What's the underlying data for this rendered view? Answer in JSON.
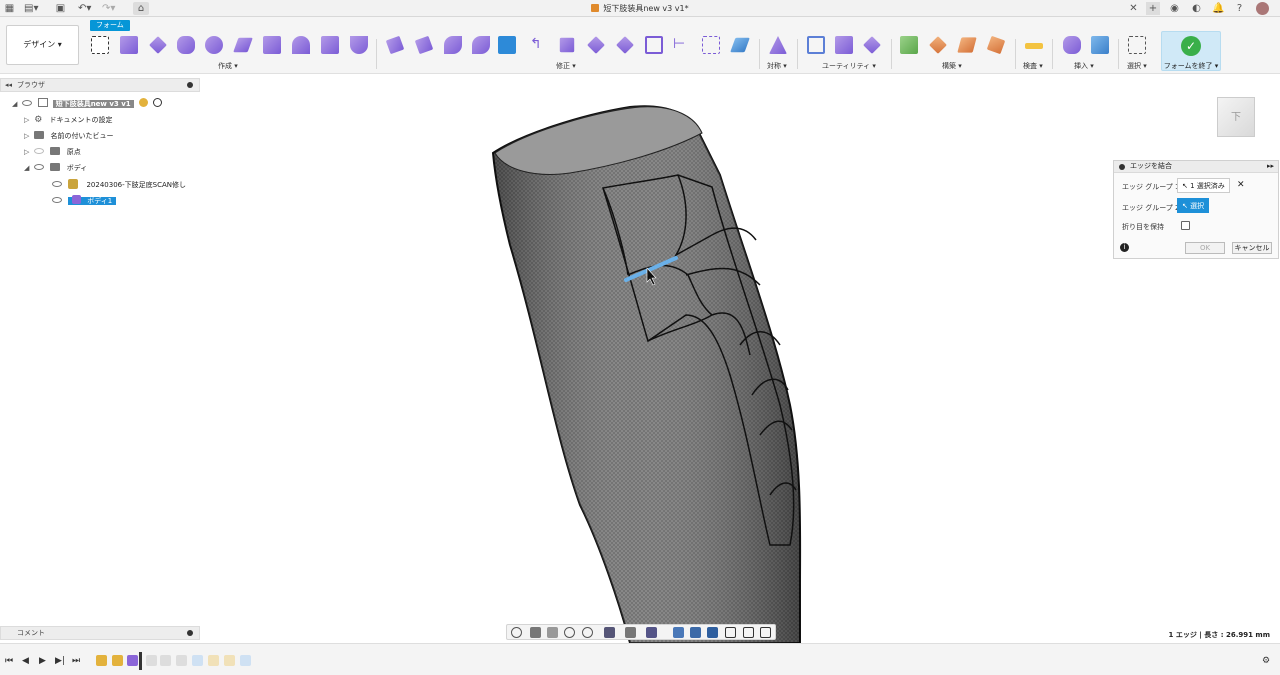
{
  "window": {
    "title": "短下肢装具new v3 v1*"
  },
  "toolbar": {
    "workspace_label": "デザイン ▾",
    "active_tab": "フォーム",
    "groups": {
      "create": "作成 ▾",
      "modify": "修正 ▾",
      "symmetry": "対称 ▾",
      "utilities": "ユーティリティ ▾",
      "construct": "構築 ▾",
      "inspect": "検査 ▾",
      "insert": "挿入 ▾",
      "select": "選択 ▾"
    },
    "finish_label": "フォームを終了 ▾"
  },
  "browser": {
    "header": "ブラウザ",
    "root": "短下肢装具new v3 v1",
    "items": [
      {
        "label": "ドキュメントの設定"
      },
      {
        "label": "名前の付いたビュー"
      },
      {
        "label": "原点"
      },
      {
        "label": "ボディ"
      },
      {
        "label": "20240306-下肢足底SCAN修し"
      },
      {
        "label": "ボディ1"
      }
    ]
  },
  "comments": {
    "header": "コメント"
  },
  "dialog": {
    "title": "エッジを結合",
    "edge_group1_label": "エッジ グループ 1",
    "edge_group1_value": "1 選択済み",
    "edge_group2_label": "エッジ グループ 2",
    "edge_group2_value": "選択",
    "keep_crease_label": "折り目を保持",
    "ok": "OK",
    "cancel": "キャンセル"
  },
  "viewcube": {
    "face": "下"
  },
  "status": {
    "selection_info": "1 エッジ | 長さ : 26.991 mm"
  },
  "colors": {
    "accent": "#1e90d8",
    "tab": "#0696d7",
    "finish_check": "#3aaf4a",
    "edge_highlight": "#6ab0e8",
    "mesh": "#6b6b6b"
  }
}
